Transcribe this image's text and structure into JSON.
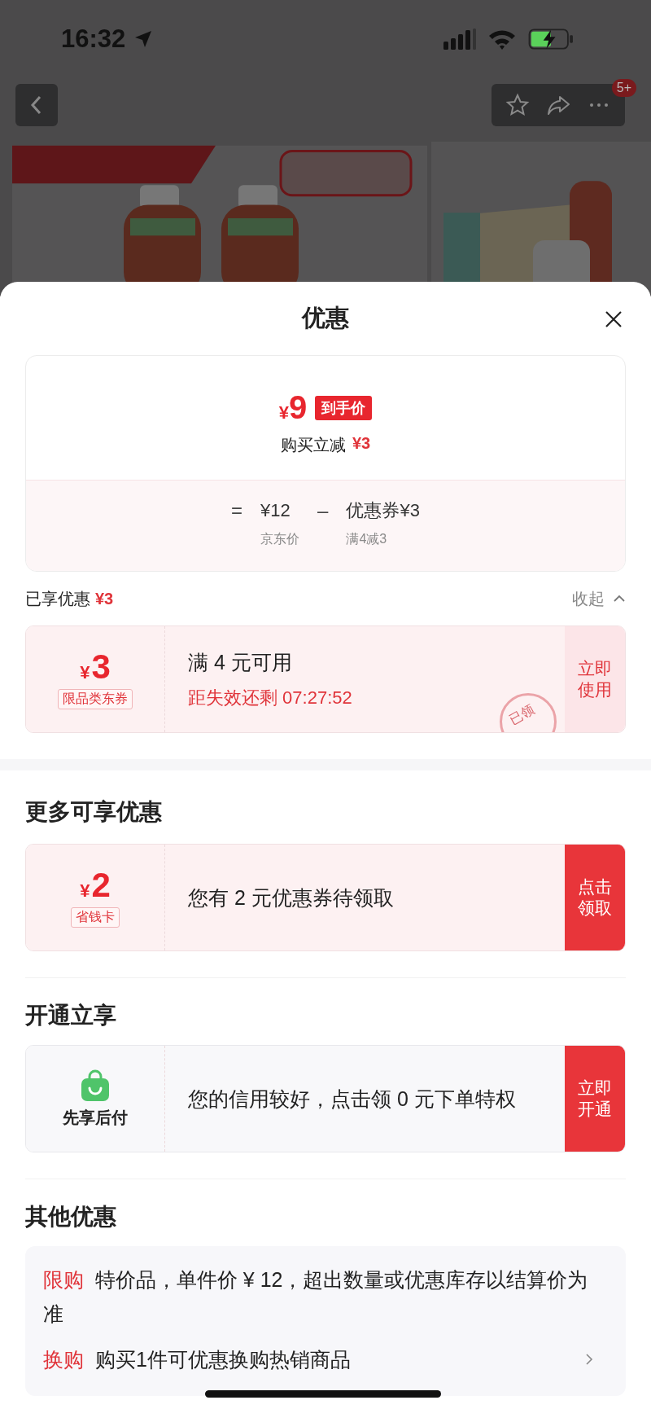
{
  "status_bar": {
    "time": "16:32"
  },
  "nav": {
    "badge": "5+"
  },
  "sheet": {
    "title": "优惠"
  },
  "summary": {
    "price_symbol": "¥",
    "price": "9",
    "price_tag": "到手价",
    "instant_label": "购买立减",
    "instant_amount": "¥3",
    "formula": [
      {
        "kind": "op",
        "text": "="
      },
      {
        "kind": "term",
        "text": "¥12",
        "label": "京东价"
      },
      {
        "kind": "op",
        "text": "–"
      },
      {
        "kind": "term",
        "text": "优惠券¥3",
        "label": "满4减3"
      }
    ]
  },
  "enjoyed": {
    "label": "已享优惠",
    "amount": "¥3",
    "toggle": "收起",
    "expanded": true
  },
  "claimed_coupons": [
    {
      "kind": "coupon",
      "symbol": "¥",
      "amount": "3",
      "tag": "限品类东券",
      "title": "满 4 元可用",
      "subtitle": "距失效还剩 07:27:52",
      "action": "立即使用",
      "claimed": true,
      "stamp": "已领"
    }
  ],
  "sections": [
    {
      "title": "更多可享优惠",
      "cards": [
        {
          "kind": "coupon",
          "symbol": "¥",
          "amount": "2",
          "tag": "省钱卡",
          "title": "您有 2 元优惠券待领取",
          "action": "点击领取",
          "claimed": false
        }
      ]
    },
    {
      "title": "开通立享",
      "cards": [
        {
          "kind": "service",
          "label": "先享后付",
          "title": "您的信用较好，点击领 0 元下单特权",
          "action": "立即开通",
          "claimed": false
        }
      ]
    }
  ],
  "other": {
    "title": "其他优惠",
    "items": [
      {
        "tag": "限购",
        "text": "特价品，单件价 ¥ 12，超出数量或优惠库存以结算价为准",
        "has_arrow": false
      },
      {
        "tag": "换购",
        "text": "购买1件可优惠换购热销商品",
        "has_arrow": true
      }
    ]
  }
}
